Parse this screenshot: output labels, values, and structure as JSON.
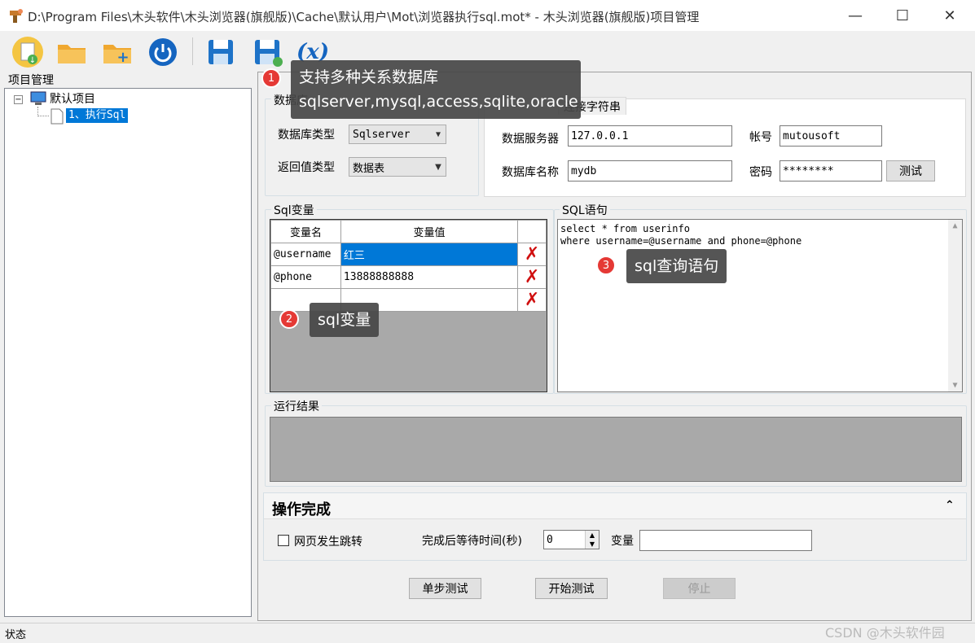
{
  "window": {
    "title": "D:\\Program Files\\木头软件\\木头浏览器(旗舰版)\\Cache\\默认用户\\Mot\\浏览器执行sql.mot* - 木头浏览器(旗舰版)项目管理",
    "minimize": "—",
    "maximize": "☐",
    "close": "✕"
  },
  "toolbar": {
    "icons": [
      "new-project-icon",
      "open-folder-icon",
      "add-folder-icon",
      "power-icon",
      "save-icon",
      "save-as-icon",
      "variable-icon"
    ],
    "variable_label": "(x)"
  },
  "left_panel": {
    "title": "项目管理",
    "tree": {
      "expander": "−",
      "root_label": "默认项目",
      "child_label": "1、执行Sql"
    }
  },
  "database_group": {
    "label": "数据库",
    "db_type_label": "数据库类型",
    "db_type_value": "Sqlserver",
    "return_type_label": "返回值类型",
    "return_type_value": "数据表"
  },
  "connection": {
    "tab_connect_string": "连接字符串",
    "server_label": "数据服务器",
    "server_value": "127.0.0.1",
    "account_label": "帐号",
    "account_value": "mutousoft",
    "dbname_label": "数据库名称",
    "dbname_value": "mydb",
    "password_label": "密码",
    "password_value": "********",
    "test_button": "测试"
  },
  "sql_vars": {
    "label": "Sql变量",
    "col_name": "变量名",
    "col_value": "变量值",
    "rows": [
      {
        "name": "@username",
        "value": "红三"
      },
      {
        "name": "@phone",
        "value": "13888888888"
      },
      {
        "name": "",
        "value": ""
      }
    ]
  },
  "sql_statement": {
    "label": "SQL语句",
    "line1": "select * from userinfo",
    "line2": "where username=@username and phone=@phone"
  },
  "result": {
    "label": "运行结果"
  },
  "operation": {
    "title": "操作完成",
    "collapse_icon": "⌃",
    "jump_label": "网页发生跳转",
    "wait_label": "完成后等待时间(秒)",
    "wait_value": "0",
    "var_label": "变量",
    "var_value": ""
  },
  "actions": {
    "step_test": "单步测试",
    "start_test": "开始测试",
    "stop": "停止"
  },
  "status": {
    "text": "状态"
  },
  "tooltips": [
    {
      "num": "1",
      "line1": "支持多种关系数据库",
      "line2": "sqlserver,mysql,access,sqlite,oracle"
    },
    {
      "num": "2",
      "line1": "sql变量"
    },
    {
      "num": "3",
      "line1": "sql查询语句"
    }
  ],
  "watermark": "CSDN @木头软件园"
}
